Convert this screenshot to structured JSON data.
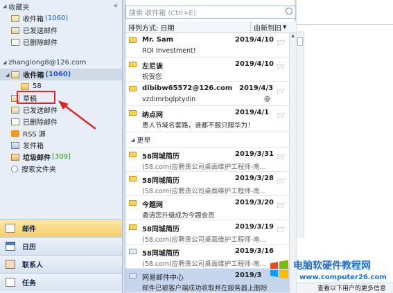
{
  "nav": {
    "favorites": {
      "header": "收藏夹",
      "items": [
        {
          "label": "收件箱",
          "count": "(1060)"
        },
        {
          "label": "已发送邮件"
        },
        {
          "label": "已删除邮件"
        }
      ]
    },
    "account": {
      "header": "zhanglong8@126.com",
      "inbox_label": "收件箱",
      "inbox_count": "(1060)",
      "subfolder": "58",
      "items": [
        {
          "label": "草稿"
        },
        {
          "label": "已发送邮件"
        },
        {
          "label": "已删除邮件"
        },
        {
          "label": "RSS 源"
        },
        {
          "label": "发件箱"
        },
        {
          "label": "垃圾邮件",
          "count": "[309]"
        },
        {
          "label": "搜索文件夹"
        }
      ]
    },
    "buttons": [
      {
        "label": "邮件"
      },
      {
        "label": "日历"
      },
      {
        "label": "联系人"
      },
      {
        "label": "任务"
      }
    ]
  },
  "list": {
    "search_placeholder": "搜索 收件箱 (Ctrl+E)",
    "sort_label": "排列方式: 日期",
    "order_label": "由新到旧",
    "group_earlier": "更早",
    "messages_recent": [
      {
        "from": "Mr. Sam",
        "date": "2019/4/10",
        "subject": "ROI Investment!"
      },
      {
        "from": "左尼诶",
        "date": "2019/4/10",
        "subject": "祝贺您"
      },
      {
        "from": "dibibw65572@126.com",
        "date": "2019/4/3",
        "subject": "vzdimrbglptydin"
      },
      {
        "from": "纳点网",
        "date": "2019/4/1",
        "subject": "愚人节域名套路，谁都不服只服华为！"
      }
    ],
    "messages_earlier": [
      {
        "from": "58同城简历",
        "date": "2019/3/31",
        "subject": "(58.com)应聘贵公司桌面维护工程师-南..."
      },
      {
        "from": "58同城简历",
        "date": "2019/3/28",
        "subject": "(58.com)应聘贵公司桌面维护工程师-南..."
      },
      {
        "from": "今题网",
        "date": "2019/3/20",
        "subject": "邀请您升级成为今题会员"
      },
      {
        "from": "58同城简历",
        "date": "2019/3/19",
        "subject": "(58.com)应聘贵公司桌面维护工程师-南..."
      },
      {
        "from": "58同城简历",
        "date": "2019/3/16",
        "subject": "(58.com)应聘贵公司桌面维护工程师-南..."
      },
      {
        "from": "网易邮件中心",
        "date": "2019/3",
        "subject": "邮件已被客户端成功收取并在服务器上删除"
      }
    ]
  },
  "reading": {
    "bottom_text": "查看以下用户的更多信息"
  },
  "watermark": {
    "title": "电脑软硬件教程网",
    "url": "www.computer26.com"
  },
  "colors": {
    "accent": "#1b6fd2",
    "highlight_box": "#e02323",
    "count_blue": "#1f56c8",
    "count_green": "#2e8b22"
  }
}
